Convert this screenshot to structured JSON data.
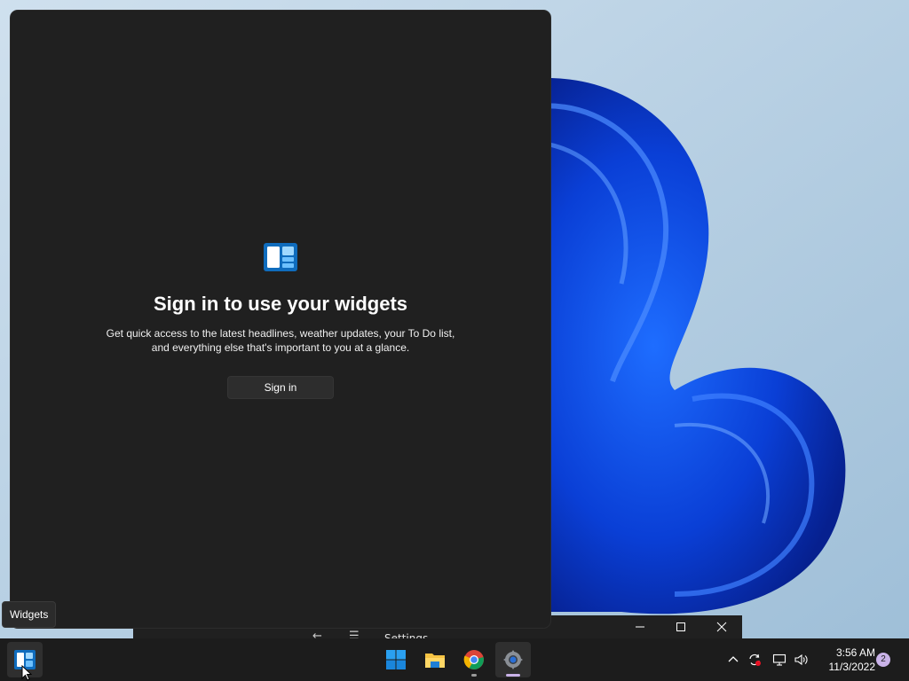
{
  "widgets_panel": {
    "heading": "Sign in to use your widgets",
    "description": "Get quick access to the latest headlines, weather updates, your To Do list, and everything else that's important to you at a glance.",
    "signin_label": "Sign in"
  },
  "tooltip": {
    "text": "Widgets"
  },
  "background_window": {
    "title": "Settings",
    "back_icon": "back-arrow-icon",
    "menu_icon": "hamburger-icon"
  },
  "taskbar": {
    "apps": [
      {
        "name": "Widgets",
        "icon": "widgets-icon"
      },
      {
        "name": "Start",
        "icon": "windows-start-icon"
      },
      {
        "name": "File Explorer",
        "icon": "folder-icon"
      },
      {
        "name": "Google Chrome",
        "icon": "chrome-icon"
      },
      {
        "name": "Settings",
        "icon": "gear-icon"
      }
    ],
    "tray": {
      "time": "3:56 AM",
      "date": "11/3/2022",
      "notification_count": "2"
    }
  },
  "colors": {
    "panel_bg": "#202020",
    "taskbar_bg": "#1c1c1c",
    "accent": "#0078d4",
    "notification_badge": "#c9b2e8"
  }
}
